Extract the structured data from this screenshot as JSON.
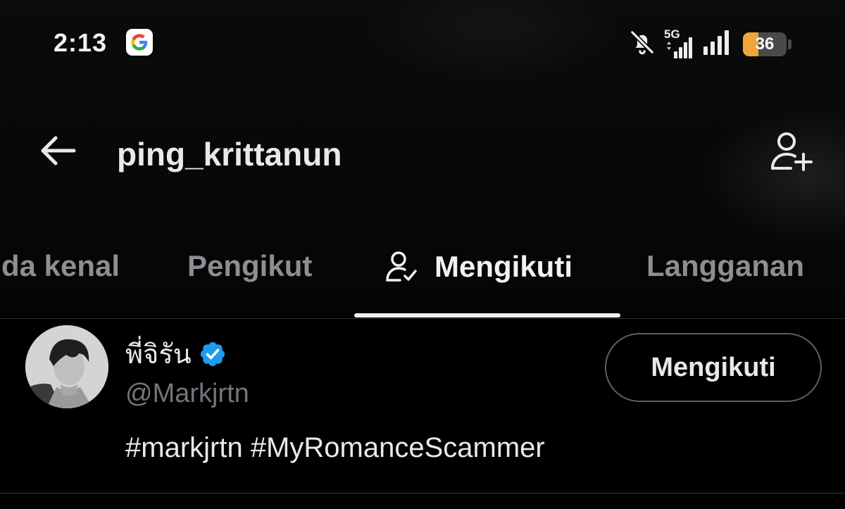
{
  "status_bar": {
    "time": "2:13",
    "network": "5G",
    "battery_level": "36",
    "battery_fraction": 0.36,
    "icons": [
      "google-icon",
      "bell-muted-icon",
      "signal-5g-icon",
      "signal-icon",
      "battery-icon"
    ]
  },
  "header": {
    "title": "ping_krittanun",
    "icons": [
      "arrow-left-icon",
      "add-user-icon"
    ]
  },
  "tabs": [
    {
      "label": "da kenal",
      "active": false
    },
    {
      "label": "Pengikut",
      "active": false
    },
    {
      "label": "Mengikuti",
      "active": true,
      "icon": "user-check-icon"
    },
    {
      "label": "Langganan",
      "active": false
    }
  ],
  "list": [
    {
      "name": "พี่จิรัน",
      "verified": true,
      "handle": "@Markjrtn",
      "bio": "#markjrtn #MyRomanceScammer",
      "button_label": "Mengikuti"
    }
  ],
  "colors": {
    "background": "#000000",
    "text_primary": "#e7e9ea",
    "text_secondary": "#71767b",
    "tab_inactive": "#8b8f93",
    "verified_blue": "#1d9bf0",
    "battery_orange": "#f0a53a",
    "button_border": "#536471"
  }
}
